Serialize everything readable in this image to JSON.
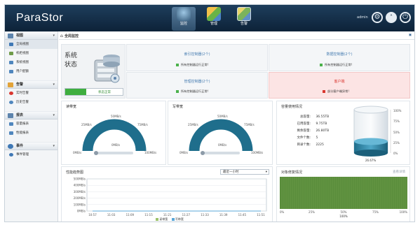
{
  "app": {
    "title": "ParaStor",
    "user": "admin"
  },
  "topnav": [
    {
      "label": "监控",
      "active": true
    },
    {
      "label": "管理",
      "active": false
    },
    {
      "label": "告警",
      "active": false
    }
  ],
  "sidebar": {
    "groups": [
      {
        "label": "视图",
        "items": [
          "全局视图",
          "机柜视图",
          "系统视图",
          "用户配额"
        ]
      },
      {
        "label": "告警",
        "items": [
          "实时告警",
          "历史告警"
        ]
      },
      {
        "label": "报表",
        "items": [
          "容量报表",
          "性能报表"
        ]
      },
      {
        "label": "事件",
        "items": [
          "事件管理"
        ]
      }
    ]
  },
  "breadcrumb": "全局监控",
  "status": {
    "title_line1": "系统",
    "title_line2": "状态",
    "badge": "状态正常",
    "boxes": [
      {
        "title": "索引控制器(2个)",
        "msg": "所有控制器运行正常!"
      },
      {
        "title": "数据控制器(2个)",
        "msg": "所有控制器运行正常!"
      },
      {
        "title": "管理控制器(2个)",
        "msg": "所有控制器运行正常!"
      },
      {
        "title": "客户端",
        "msg": "部分客户端异常!"
      }
    ]
  },
  "read_gauge": {
    "title": "读带宽",
    "labels": [
      "0MB/s",
      "25MB/s",
      "50MB/s",
      "75MB/s",
      "100MB/s"
    ],
    "value_label": "0MB/s"
  },
  "write_gauge": {
    "title": "写带宽",
    "labels": [
      "0MB/s",
      "25MB/s",
      "50MB/s",
      "75MB/s",
      "100MB/s"
    ],
    "value_label": "0MB/s"
  },
  "capacity": {
    "title": "容量使用情况",
    "rows": [
      {
        "k": "总容量:",
        "v": "36.55TB"
      },
      {
        "k": "已用容量:",
        "v": "9.75TB"
      },
      {
        "k": "剩余容量:",
        "v": "26.80TB"
      },
      {
        "k": "文件个数:",
        "v": "5"
      },
      {
        "k": "目录个数:",
        "v": "2225"
      }
    ],
    "ticks": [
      "100%",
      "75%",
      "50%",
      "25%",
      "0%"
    ],
    "percent_label": "26.67%",
    "fill": 0.2667
  },
  "perf": {
    "title": "性能趋势图",
    "select": "最近一小时",
    "legend": [
      "读带宽",
      "写带宽"
    ]
  },
  "share": {
    "title": "对象修复情况",
    "link": "查看详情",
    "ticks": [
      "0%",
      "25%",
      "50%",
      "75%",
      "100%"
    ],
    "bottom": "100%"
  },
  "chart_data": [
    {
      "type": "line",
      "title": "性能趋势图",
      "categories": [
        "10:57",
        "11:03",
        "11:09",
        "11:15",
        "11:21",
        "11:27",
        "11:33",
        "11:39",
        "11:45",
        "11:51"
      ],
      "yticks": [
        "500MB/s",
        "400MB/s",
        "300MB/s",
        "200MB/s",
        "100MB/s",
        "0MB/s"
      ],
      "ylim": [
        0,
        500
      ],
      "series": [
        {
          "name": "读带宽",
          "values": [
            0,
            0,
            0,
            0,
            0,
            0,
            0,
            0,
            0,
            0
          ]
        },
        {
          "name": "写带宽",
          "values": [
            0,
            0,
            0,
            0,
            0,
            0,
            0,
            0,
            0,
            0
          ]
        }
      ]
    },
    {
      "type": "bar",
      "title": "对象修复情况",
      "xlim": [
        0,
        100
      ],
      "values": [
        100
      ]
    }
  ],
  "colors": {
    "accent": "#1f6e8c",
    "ok": "#4bb14b",
    "error": "#d9362f",
    "chart_green": "#5a8d3c"
  }
}
